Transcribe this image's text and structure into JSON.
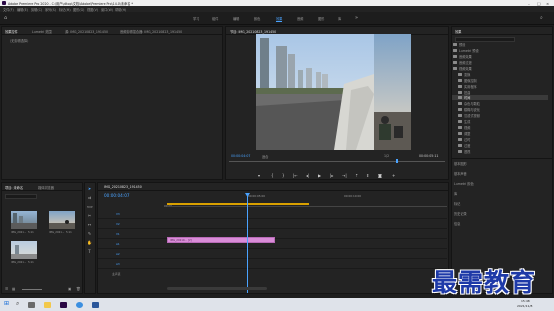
{
  "window": {
    "title": "Adobe Premiere Pro 2020 - C:\\用户\\ditop\\文档\\Adobe\\Premiere Pro\\14.0\\未命名 *"
  },
  "menubar": {
    "items": [
      "文件(F)",
      "编辑(E)",
      "剪辑(C)",
      "序列(S)",
      "标记(M)",
      "图形(G)",
      "视图(V)",
      "窗口(W)",
      "帮助(H)"
    ]
  },
  "workspaces": {
    "items": [
      "学习",
      "组件",
      "编辑",
      "颜色",
      "效果",
      "音频",
      "图形",
      "库"
    ],
    "active": "效果"
  },
  "source_panel": {
    "tabs": [
      "效果控件",
      "Lumetri 范围",
      "源: IMG_20210823_191450",
      "音频剪辑混合器: IMG_20210823_191450"
    ],
    "subtitle": "（无剪辑选择）"
  },
  "program_monitor": {
    "tab": "节目: IMG_20210823_191450",
    "timecode_left": "00:00:04:07",
    "fit_label": "适合",
    "quality": "1/2",
    "timecode_right": "00:00:05:11"
  },
  "project_panel": {
    "tabs": [
      "项目: 未命名",
      "媒体浏览器"
    ],
    "search_placeholder": "",
    "item_count": "",
    "clips": [
      {
        "name": "IMG_2021...",
        "duration": "5:11"
      },
      {
        "name": "IMG_2021...",
        "duration": "5:11"
      },
      {
        "name": "IMG_2021...",
        "duration": "5:11"
      }
    ]
  },
  "timeline": {
    "tab": "IMG_20210823_191450",
    "timecode": "00:00:04:07",
    "ruler": [
      "00:00",
      "00:00:05:00",
      "00:00:10:00"
    ],
    "tracks": [
      "V3",
      "V2",
      "V1",
      "A1",
      "A2",
      "A3",
      "主声道"
    ],
    "clip_label": "IMG_20210... [V]"
  },
  "effects_panel": {
    "title": "效果",
    "items": [
      "预设",
      "Lumetri 预设",
      "音频效果",
      "音频过渡",
      "视频效果",
      "变换",
      "图像控制",
      "实用程序",
      "扭曲",
      "时间",
      "杂色与颗粒",
      "模糊与锐化",
      "沉浸式视频",
      "生成",
      "视频",
      "调整",
      "过时",
      "过渡",
      "透视",
      "通道",
      "键控",
      "颜色校正",
      "风格化"
    ],
    "side_panels": [
      "基本图形",
      "基本声音",
      "Lumetri 颜色",
      "库",
      "标记",
      "历史记录",
      "信息"
    ]
  },
  "taskbar": {
    "time": "15:48",
    "date": "2021/11/8"
  },
  "watermark": {
    "text": "最需教育"
  },
  "colors": {
    "accent": "#4aa3ff",
    "clip": "#d98cd8",
    "playhead": "#4aa3ff"
  }
}
